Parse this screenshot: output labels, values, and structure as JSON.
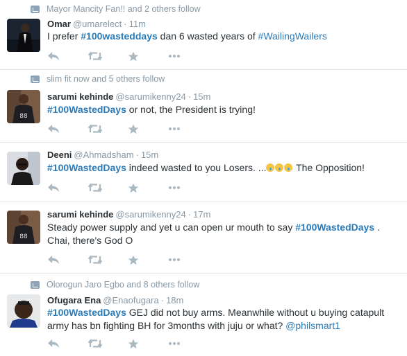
{
  "tweets": [
    {
      "context": "Mayor Mancity Fan!! and 2 others follow",
      "name": "Omar",
      "handle": "@umarelect",
      "dot": "·",
      "time": "11m",
      "text": [
        {
          "t": "I prefer "
        },
        {
          "t": "#100wasteddays",
          "k": "tag"
        },
        {
          "t": " dan 6 wasted years of "
        },
        {
          "t": "#WailingWailers",
          "k": "mention"
        }
      ]
    },
    {
      "context": "slim fit now and 5 others follow",
      "name": "sarumi kehinde",
      "handle": "@sarumikenny24",
      "dot": "·",
      "time": "15m",
      "text": [
        {
          "t": "#100WastedDays",
          "k": "tag"
        },
        {
          "t": " or not, the President is trying!"
        }
      ]
    },
    {
      "context": "",
      "name": "Deeni",
      "handle": "@Ahmadsham",
      "dot": "·",
      "time": "15m",
      "text": [
        {
          "t": "#100WastedDays",
          "k": "tag"
        },
        {
          "t": " indeed wasted to you Losers. ..."
        },
        {
          "k": "emoji"
        },
        {
          "k": "emoji"
        },
        {
          "k": "emoji"
        },
        {
          "t": " The Opposition!"
        }
      ]
    },
    {
      "context": "",
      "name": "sarumi kehinde",
      "handle": "@sarumikenny24",
      "dot": "·",
      "time": "17m",
      "text": [
        {
          "t": "Steady power supply and yet u can open ur mouth to say "
        },
        {
          "t": "#100WastedDays",
          "k": "tag"
        },
        {
          "t": " . Chai, there's God O"
        }
      ]
    },
    {
      "context": "Olorogun Jaro Egbo and 8 others follow",
      "name": "Ofugara Ena",
      "handle": "@Enaofugara",
      "dot": "·",
      "time": "18m",
      "text": [
        {
          "t": "#100WastedDays",
          "k": "tag"
        },
        {
          "t": " GEJ did not buy arms. Meanwhile without u buying catapult army has bn fighting BH for 3months with juju or what? "
        },
        {
          "t": "@philsmart1",
          "k": "mention"
        }
      ]
    }
  ],
  "actions": [
    "reply-icon",
    "retweet-icon",
    "favorite-icon",
    "more-icon"
  ],
  "colors": {
    "link": "#2a7ab8",
    "muted": "#8899a6",
    "icon": "#aab8c2",
    "border": "#e1e8ed"
  }
}
